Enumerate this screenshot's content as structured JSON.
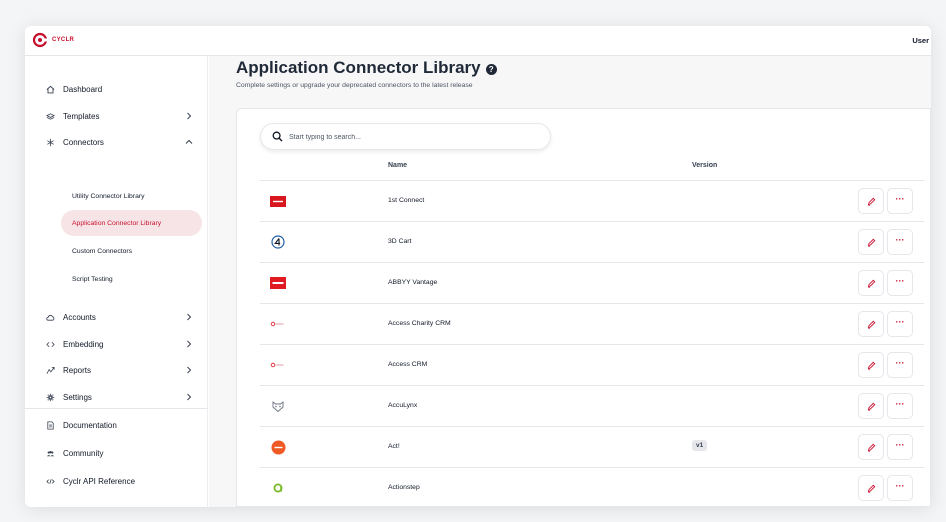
{
  "app": {
    "logo_text": "CYCLR",
    "user_label": "User",
    "brand_color": "#c8102e"
  },
  "sidebar": {
    "items": [
      {
        "label": "Dashboard",
        "icon": "home-icon"
      },
      {
        "label": "Templates",
        "icon": "layers-icon",
        "chevron": "right"
      },
      {
        "label": "Connectors",
        "icon": "asterisk-icon",
        "chevron": "up"
      },
      {
        "label": "Accounts",
        "icon": "cloud-icon",
        "chevron": "right"
      },
      {
        "label": "Embedding",
        "icon": "code-icon",
        "chevron": "right"
      },
      {
        "label": "Reports",
        "icon": "chart-icon",
        "chevron": "right"
      },
      {
        "label": "Settings",
        "icon": "gear-icon",
        "chevron": "right"
      }
    ],
    "connector_subitems": [
      {
        "label": "Utility Connector Library",
        "active": false
      },
      {
        "label": "Application Connector Library",
        "active": true
      },
      {
        "label": "Custom Connectors",
        "active": false
      },
      {
        "label": "Script Testing",
        "active": false
      }
    ],
    "footer_items": [
      {
        "label": "Documentation",
        "icon": "document-icon"
      },
      {
        "label": "Community",
        "icon": "users-icon"
      },
      {
        "label": "Cyclr API Reference",
        "icon": "code-tag-icon"
      }
    ]
  },
  "main": {
    "title": "Application Connector Library",
    "subtitle": "Complete settings or upgrade your deprecated connectors to the latest release",
    "search": {
      "placeholder": "Start typing to search..."
    },
    "columns": {
      "name": "Name",
      "version": "Version"
    },
    "rows": [
      {
        "name": "1st Connect",
        "version": "",
        "logo": "1st-connect-logo"
      },
      {
        "name": "3D Cart",
        "version": "",
        "logo": "3d-cart-logo"
      },
      {
        "name": "ABBYY Vantage",
        "version": "",
        "logo": "abbyy-logo"
      },
      {
        "name": "Access Charity CRM",
        "version": "",
        "logo": "access-logo"
      },
      {
        "name": "Access CRM",
        "version": "",
        "logo": "access-logo"
      },
      {
        "name": "AccuLynx",
        "version": "",
        "logo": "acculynx-logo"
      },
      {
        "name": "Act!",
        "version": "v1",
        "logo": "act-logo"
      },
      {
        "name": "Actionstep",
        "version": "",
        "logo": "actionstep-logo"
      }
    ]
  }
}
